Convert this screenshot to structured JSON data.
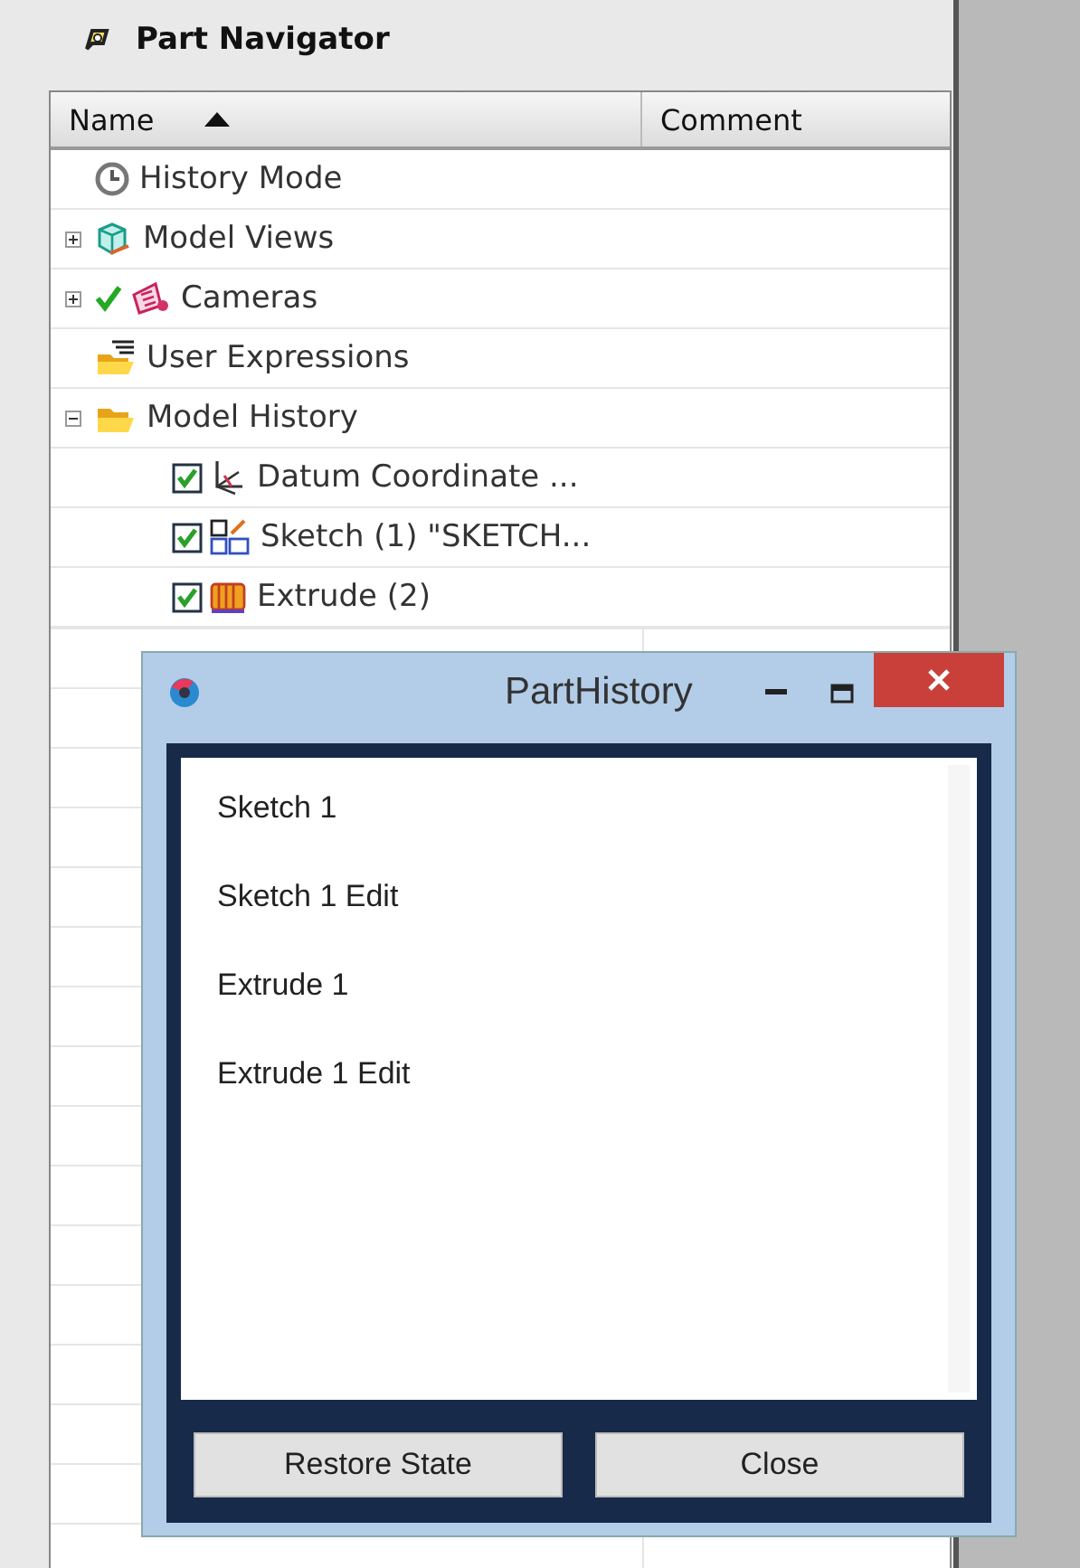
{
  "navigator": {
    "title": "Part Navigator",
    "columns": [
      {
        "label": "Name",
        "sorted_ascending": true
      },
      {
        "label": "Comment"
      }
    ],
    "tree": [
      {
        "label": "History Mode",
        "kind": "clock"
      },
      {
        "label": "Model Views",
        "kind": "views",
        "expanded": false
      },
      {
        "label": "Cameras",
        "kind": "camera",
        "expanded": false,
        "ticked": true
      },
      {
        "label": "User Expressions",
        "kind": "expressions"
      },
      {
        "label": "Model History",
        "kind": "folder",
        "expanded": true,
        "children": [
          {
            "label": "Datum Coordinate ...",
            "kind": "datum",
            "checked": true
          },
          {
            "label": "Sketch (1) \"SKETCH...",
            "kind": "sketch",
            "checked": true
          },
          {
            "label": "Extrude (2)",
            "kind": "extrude",
            "checked": true
          }
        ]
      }
    ]
  },
  "dialog": {
    "title": "PartHistory",
    "items": [
      "Sketch 1",
      "Sketch 1 Edit",
      "Extrude 1",
      "Extrude 1 Edit"
    ],
    "buttons": [
      "Restore State",
      "Close"
    ]
  }
}
